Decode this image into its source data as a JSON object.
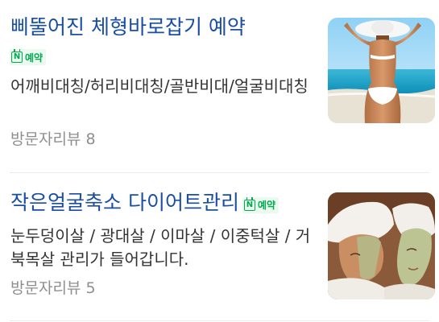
{
  "listings": [
    {
      "title": "삐뚤어진 체형바로잡기 예약",
      "badge": {
        "icon": "naver-booking-icon",
        "letter": "N",
        "label": "예약",
        "color": "#03a94e"
      },
      "description": "어깨비대칭/허리비대칭/골반비대/얼굴비대칭",
      "review_label": "방문자리뷰",
      "review_count": "8",
      "image": "woman-in-bikini-at-beach"
    },
    {
      "title": "작은얼굴축소 다이어트관리",
      "badge": {
        "icon": "naver-booking-icon",
        "letter": "N",
        "label": "예약",
        "color": "#03a94e"
      },
      "description": "눈두덩이살 / 광대살 / 이마살 / 이중턱살 / 거북목살 관리가 들어갑니다.",
      "review_label": "방문자리뷰",
      "review_count": "5",
      "image": "women-with-facial-masks"
    }
  ],
  "colors": {
    "title": "#1a4ea3",
    "description": "#333333",
    "meta": "#8e8e8e"
  }
}
